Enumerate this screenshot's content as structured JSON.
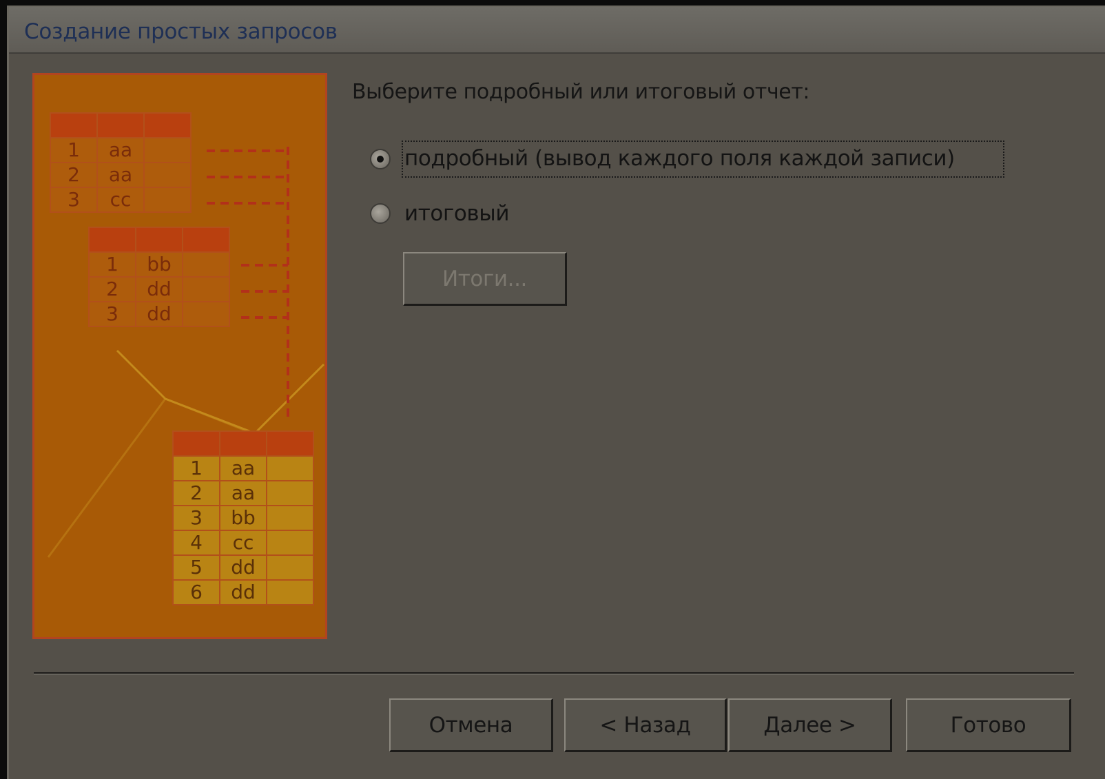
{
  "window": {
    "title": "Создание простых запросов"
  },
  "illustration": {
    "source_table_1": [
      [
        "1",
        "aa"
      ],
      [
        "2",
        "aa"
      ],
      [
        "3",
        "cc"
      ]
    ],
    "source_table_2": [
      [
        "1",
        "bb"
      ],
      [
        "2",
        "dd"
      ],
      [
        "3",
        "dd"
      ]
    ],
    "result_table": [
      [
        "1",
        "aa"
      ],
      [
        "2",
        "aa"
      ],
      [
        "3",
        "bb"
      ],
      [
        "4",
        "cc"
      ],
      [
        "5",
        "dd"
      ],
      [
        "6",
        "dd"
      ]
    ]
  },
  "main": {
    "prompt": "Выберите подробный или итоговый отчет:",
    "option_detail": {
      "label": "подробный (вывод каждого поля каждой записи)",
      "selected": true
    },
    "option_summary": {
      "label": "итоговый",
      "selected": false
    },
    "summary_button": "Итоги..."
  },
  "footer": {
    "cancel": "Отмена",
    "back": "< Назад",
    "next": "Далее >",
    "finish": "Готово"
  },
  "colors": {
    "background": "#545049",
    "illustration": "#a85a06",
    "title_text": "#1e2f55"
  }
}
